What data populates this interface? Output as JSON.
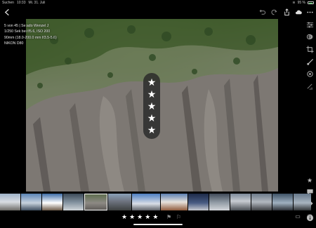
{
  "status": {
    "carrier": "Suchen",
    "time": "10:33",
    "date": "Mi. 31. Juli",
    "battery": "95 %",
    "battery_level": 0.95
  },
  "toolbar": {
    "back_icon": "chevron-left-icon",
    "right_icons": [
      "undo-icon",
      "undo-alt-icon",
      "redo-icon",
      "share-icon",
      "cloud-sync-icon",
      "more-icon"
    ]
  },
  "photo_meta": {
    "line1": "5 von 45 | Se:ado Wenzel J",
    "line2": "1/250 Sek bei f/5.6, ISO 200",
    "line3": "90mm (18.0-200.0 mm f/3.5-5.6)",
    "line4": "NIKON D80"
  },
  "rating": {
    "value": 5,
    "max": 5,
    "star": "★"
  },
  "right_panel": [
    "sliders-icon",
    "presets-icon",
    "crop-icon",
    "brush-icon",
    "selective-icon",
    "healing-icon",
    "star-icon",
    "comment-icon",
    "tag-icon",
    "info-icon"
  ],
  "bottom": {
    "stars": [
      "★",
      "★",
      "★",
      "★",
      "★"
    ],
    "flag_pick": "⚑",
    "flag_reject": "⚐"
  },
  "colors": {
    "accent": "#ffffff",
    "panel": "#000000"
  }
}
